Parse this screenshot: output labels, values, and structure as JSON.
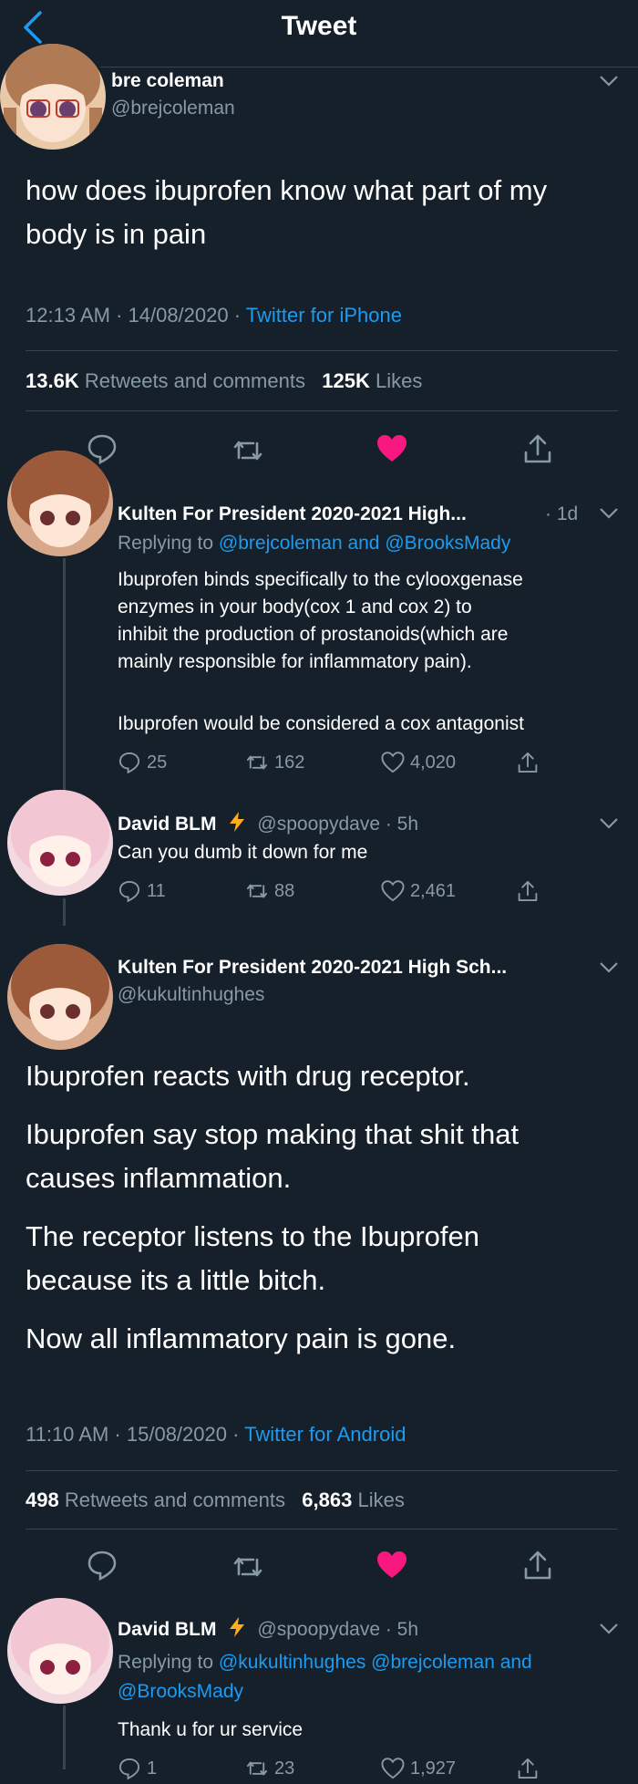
{
  "header": {
    "title": "Tweet"
  },
  "main_tweet": {
    "name": "bre coleman",
    "handle": "@brejcoleman",
    "text_lines": [
      "how does ibuprofen know what part of my",
      "body is in pain"
    ],
    "time": "12:13 AM · 14/08/2020 · ",
    "source": "Twitter for iPhone",
    "retweets": "13.6K",
    "retweets_label": "Retweets and comments",
    "likes": "125K",
    "likes_label": "Likes"
  },
  "reply1": {
    "name": "Kulten For President 2020-2021 High...",
    "age": "· 1d",
    "replying_prefix": "Replying to ",
    "replying_to": "@brejcoleman and @BrooksMady",
    "lines": [
      "Ibuprofen binds specifically to the cylooxgenase",
      "enzymes in your body(cox 1 and cox 2) to",
      "inhibit the production of prostanoids(which are",
      "mainly responsible for inflammatory pain)."
    ],
    "line2": "Ibuprofen would be considered a cox antagonist",
    "replies": "25",
    "retweets": "162",
    "likes": "4,020"
  },
  "reply2": {
    "name": "David BLM",
    "handle_time": "@spoopydave · 5h",
    "text": "Can you dumb it down for me",
    "replies": "11",
    "retweets": "88",
    "likes": "2,461"
  },
  "second_tweet": {
    "name": "Kulten For President 2020-2021 High Sch...",
    "handle": "@kukultinhughes",
    "paragraphs": [
      [
        "Ibuprofen reacts with drug receptor."
      ],
      [
        "Ibuprofen say stop making that shit that",
        "causes inflammation."
      ],
      [
        "The receptor listens to the Ibuprofen",
        "because its a little bitch."
      ],
      [
        "Now all inflammatory pain is gone."
      ]
    ],
    "time": "11:10 AM · 15/08/2020 · ",
    "source": "Twitter for Android",
    "retweets": "498",
    "retweets_label": "Retweets and comments",
    "likes": "6,863",
    "likes_label": "Likes"
  },
  "reply3": {
    "name": "David BLM",
    "handle_time": "@spoopydave · 5h",
    "replying_prefix": "Replying to ",
    "replying_line1": "@kukultinhughes @brejcoleman and",
    "replying_line2": "@BrooksMady",
    "text": "Thank u for ur service",
    "replies": "1",
    "retweets": "23",
    "likes": "1,927"
  },
  "colors": {
    "background": "#15202b",
    "accent": "#1d9bf0",
    "like": "#f91880",
    "muted": "#8899a6"
  },
  "icons": [
    "back-icon",
    "chevron-down-icon",
    "reply-icon",
    "retweet-icon",
    "like-icon",
    "share-icon",
    "lightning-icon"
  ]
}
